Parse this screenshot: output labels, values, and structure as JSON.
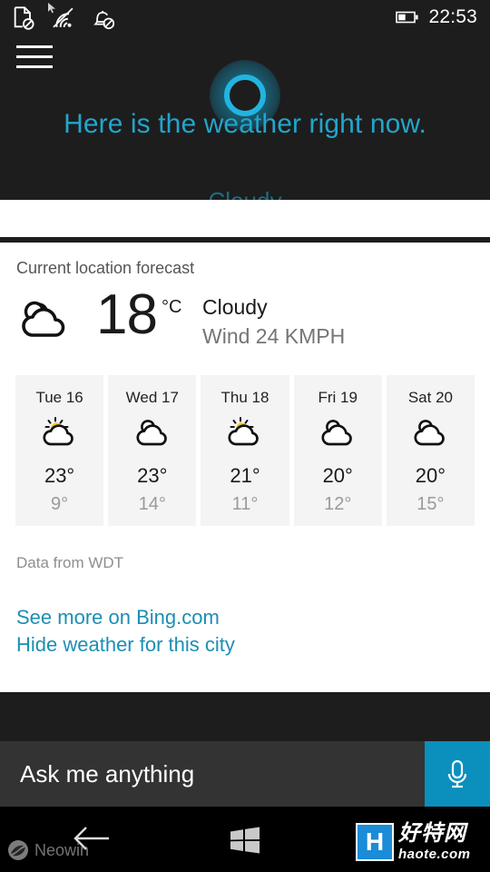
{
  "statusbar": {
    "icons": [
      {
        "name": "sim-missing-icon"
      },
      {
        "name": "wifi-icon"
      },
      {
        "name": "notifications-off-icon"
      }
    ],
    "battery_icon": "battery-half-icon",
    "clock": "22:53"
  },
  "hero": {
    "menu_icon": "hamburger-menu-icon",
    "cortana_icon": "cortana-ring-icon",
    "response_line": "Here is the weather right now.",
    "response_line_cut": "Cloudy",
    "accent_color": "#22a5cc"
  },
  "weather": {
    "card_title": "Current location forecast",
    "current": {
      "icon": "cloudy-icon",
      "temperature": "18",
      "unit": "°C",
      "condition": "Cloudy",
      "wind": "Wind 24 KMPH"
    },
    "forecast": [
      {
        "day": "Tue 16",
        "icon": "sun-behind-cloud-icon",
        "high": "23°",
        "low": "9°"
      },
      {
        "day": "Wed 17",
        "icon": "cloudy-icon",
        "high": "23°",
        "low": "14°"
      },
      {
        "day": "Thu 18",
        "icon": "sun-behind-cloud-icon",
        "high": "21°",
        "low": "11°"
      },
      {
        "day": "Fri 19",
        "icon": "cloudy-icon",
        "high": "20°",
        "low": "12°"
      },
      {
        "day": "Sat 20",
        "icon": "cloudy-icon",
        "high": "20°",
        "low": "15°"
      }
    ],
    "attribution": "Data from WDT",
    "link_more": "See more on Bing.com",
    "link_hide": "Hide weather for this city",
    "link_color": "#1b8fb3"
  },
  "askbar": {
    "placeholder": "Ask me anything",
    "value": "",
    "mic_icon": "microphone-icon",
    "mic_color": "#0b8fbd"
  },
  "navbar": {
    "back_icon": "back-arrow-icon",
    "start_icon": "windows-start-icon"
  },
  "watermarks": {
    "neowin": {
      "icon": "neowin-logo-icon",
      "text": "Neowin"
    },
    "haote": {
      "badge": "H",
      "chinese": "好特网",
      "domain": "haote.com"
    }
  }
}
